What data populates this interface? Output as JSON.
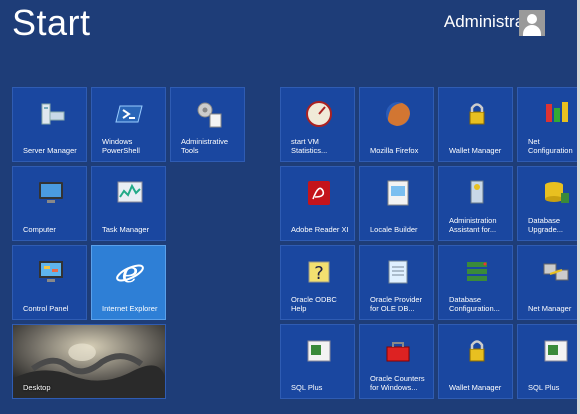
{
  "header": {
    "title": "Start",
    "user_name": "Administrator"
  },
  "tiles": {
    "server_manager": "Server Manager",
    "windows_powershell": "Windows\nPowerShell",
    "administrative_tools": "Administrative\nTools",
    "computer": "Computer",
    "task_manager": "Task Manager",
    "control_panel": "Control Panel",
    "internet_explorer": "Internet Explorer",
    "desktop": "Desktop",
    "start_vm_statistics": "start VM\nStatistics...",
    "mozilla_firefox": "Mozilla Firefox",
    "wallet_manager_1": "Wallet Manager",
    "net_configuration": "Net\nConfiguration",
    "adobe_reader": "Adobe Reader XI",
    "locale_builder": "Locale Builder",
    "admin_assistant": "Administration\nAssistant for...",
    "database_upgrade": "Database\nUpgrade...",
    "oracle_odbc_help": "Oracle ODBC\nHelp",
    "oracle_provider": "Oracle Provider\nfor OLE DB...",
    "database_configuration": "Database\nConfiguration...",
    "net_manager": "Net Manager",
    "sql_plus_1": "SQL Plus",
    "oracle_counters": "Oracle Counters\nfor Windows...",
    "wallet_manager_2": "Wallet Manager",
    "sql_plus_2": "SQL Plus"
  },
  "colors": {
    "background": "#1e3d78",
    "tile": "#1a47a0",
    "tile_selected": "#2e7fd6"
  }
}
